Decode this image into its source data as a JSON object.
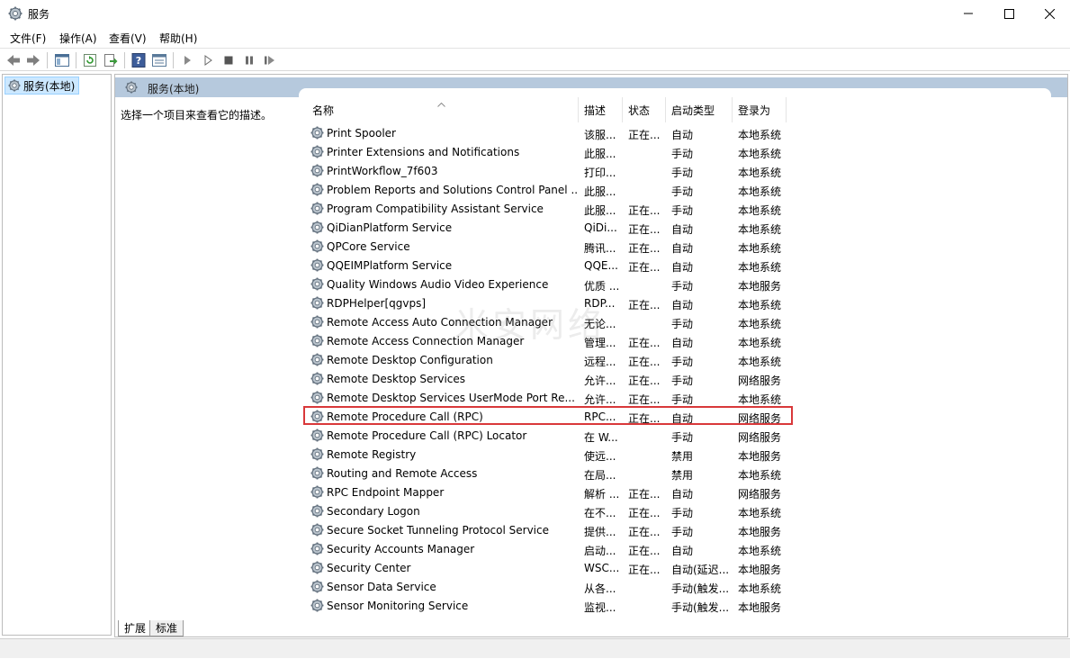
{
  "window": {
    "title": "服务"
  },
  "menu": [
    {
      "label": "文件(F)"
    },
    {
      "label": "操作(A)"
    },
    {
      "label": "查看(V)"
    },
    {
      "label": "帮助(H)"
    }
  ],
  "tree": {
    "item": "服务(本地)"
  },
  "main": {
    "header_title": "服务(本地)",
    "description_hint": "选择一个项目来查看它的描述。"
  },
  "columns": {
    "name": "名称",
    "description": "描述",
    "status": "状态",
    "startup": "启动类型",
    "logon": "登录为"
  },
  "services": [
    {
      "name": "Print Spooler",
      "desc": "该服...",
      "status": "正在...",
      "startup": "自动",
      "logon": "本地系统"
    },
    {
      "name": "Printer Extensions and Notifications",
      "desc": "此服...",
      "status": "",
      "startup": "手动",
      "logon": "本地系统"
    },
    {
      "name": "PrintWorkflow_7f603",
      "desc": "打印...",
      "status": "",
      "startup": "手动",
      "logon": "本地系统"
    },
    {
      "name": "Problem Reports and Solutions Control Panel ...",
      "desc": "此服...",
      "status": "",
      "startup": "手动",
      "logon": "本地系统"
    },
    {
      "name": "Program Compatibility Assistant Service",
      "desc": "此服...",
      "status": "正在...",
      "startup": "手动",
      "logon": "本地系统"
    },
    {
      "name": "QiDianPlatform Service",
      "desc": "QiDi...",
      "status": "正在...",
      "startup": "自动",
      "logon": "本地系统"
    },
    {
      "name": "QPCore Service",
      "desc": "腾讯...",
      "status": "正在...",
      "startup": "自动",
      "logon": "本地系统"
    },
    {
      "name": "QQEIMPlatform Service",
      "desc": "QQE...",
      "status": "正在...",
      "startup": "自动",
      "logon": "本地系统"
    },
    {
      "name": "Quality Windows Audio Video Experience",
      "desc": "优质 ...",
      "status": "",
      "startup": "手动",
      "logon": "本地服务"
    },
    {
      "name": "RDPHelper[qgvps]",
      "desc": "RDP...",
      "status": "正在...",
      "startup": "自动",
      "logon": "本地系统"
    },
    {
      "name": "Remote Access Auto Connection Manager",
      "desc": "无论...",
      "status": "",
      "startup": "手动",
      "logon": "本地系统"
    },
    {
      "name": "Remote Access Connection Manager",
      "desc": "管理...",
      "status": "正在...",
      "startup": "自动",
      "logon": "本地系统"
    },
    {
      "name": "Remote Desktop Configuration",
      "desc": "远程...",
      "status": "正在...",
      "startup": "手动",
      "logon": "本地系统"
    },
    {
      "name": "Remote Desktop Services",
      "desc": "允许...",
      "status": "正在...",
      "startup": "手动",
      "logon": "网络服务"
    },
    {
      "name": "Remote Desktop Services UserMode Port Re...",
      "desc": "允许...",
      "status": "正在...",
      "startup": "手动",
      "logon": "本地系统"
    },
    {
      "name": "Remote Procedure Call (RPC)",
      "desc": "RPC...",
      "status": "正在...",
      "startup": "自动",
      "logon": "网络服务"
    },
    {
      "name": "Remote Procedure Call (RPC) Locator",
      "desc": "在 W...",
      "status": "",
      "startup": "手动",
      "logon": "网络服务"
    },
    {
      "name": "Remote Registry",
      "desc": "使远...",
      "status": "",
      "startup": "禁用",
      "logon": "本地服务"
    },
    {
      "name": "Routing and Remote Access",
      "desc": "在局...",
      "status": "",
      "startup": "禁用",
      "logon": "本地系统"
    },
    {
      "name": "RPC Endpoint Mapper",
      "desc": "解析 ...",
      "status": "正在...",
      "startup": "自动",
      "logon": "网络服务"
    },
    {
      "name": "Secondary Logon",
      "desc": "在不...",
      "status": "正在...",
      "startup": "手动",
      "logon": "本地系统"
    },
    {
      "name": "Secure Socket Tunneling Protocol Service",
      "desc": "提供...",
      "status": "正在...",
      "startup": "手动",
      "logon": "本地服务"
    },
    {
      "name": "Security Accounts Manager",
      "desc": "启动...",
      "status": "正在...",
      "startup": "自动",
      "logon": "本地系统"
    },
    {
      "name": "Security Center",
      "desc": "WSC...",
      "status": "正在...",
      "startup": "自动(延迟...",
      "logon": "本地服务"
    },
    {
      "name": "Sensor Data Service",
      "desc": "从各...",
      "status": "",
      "startup": "手动(触发...",
      "logon": "本地系统"
    },
    {
      "name": "Sensor Monitoring Service",
      "desc": "监视...",
      "status": "",
      "startup": "手动(触发...",
      "logon": "本地服务"
    }
  ],
  "tabs": [
    {
      "label": "扩展"
    },
    {
      "label": "标准"
    }
  ],
  "watermark": "米安网络",
  "highlight_color": "#d9383a"
}
